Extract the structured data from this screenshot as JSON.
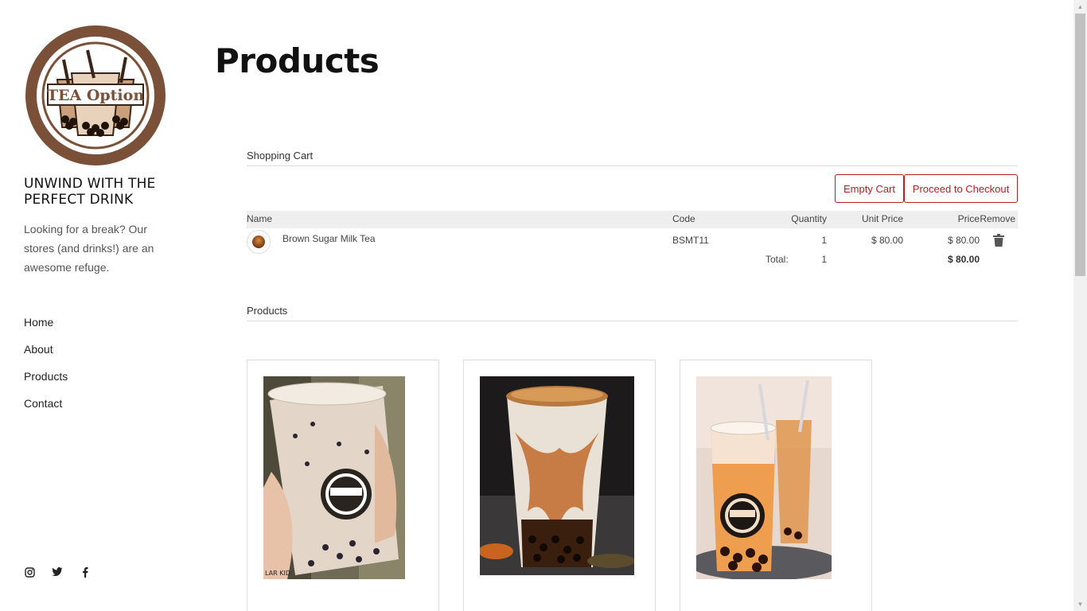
{
  "brand": {
    "logo_text": "TEA Option",
    "tagline": "UNWIND WITH THE PERFECT DRINK",
    "intro": "Looking for a break? Our stores (and drinks!) are an awesome refuge."
  },
  "nav": {
    "items": [
      {
        "label": "Home"
      },
      {
        "label": "About"
      },
      {
        "label": "Products"
      },
      {
        "label": "Contact"
      }
    ]
  },
  "social": [
    "instagram-icon",
    "twitter-icon",
    "facebook-icon"
  ],
  "page": {
    "title": "Products"
  },
  "cart": {
    "heading": "Shopping Cart",
    "empty_label": "Empty Cart",
    "checkout_label": "Proceed to Checkout",
    "columns": {
      "name": "Name",
      "code": "Code",
      "quantity": "Quantity",
      "unit_price": "Unit Price",
      "price": "Price",
      "remove": "Remove"
    },
    "items": [
      {
        "name": "Brown Sugar Milk Tea",
        "code": "BSMT11",
        "quantity": "1",
        "unit_price": "$ 80.00",
        "price": "$ 80.00"
      }
    ],
    "total_label": "Total:",
    "total_quantity": "1",
    "total_price": "$ 80.00"
  },
  "products": {
    "heading": "Products",
    "items": [
      {
        "image": "milk-tea-cup-photo"
      },
      {
        "image": "brown-sugar-boba-photo"
      },
      {
        "image": "thai-milk-tea-photo"
      }
    ]
  },
  "colors": {
    "accent": "#b22222",
    "brand_brown": "#7a5038",
    "header_bg": "#eeeeee"
  }
}
